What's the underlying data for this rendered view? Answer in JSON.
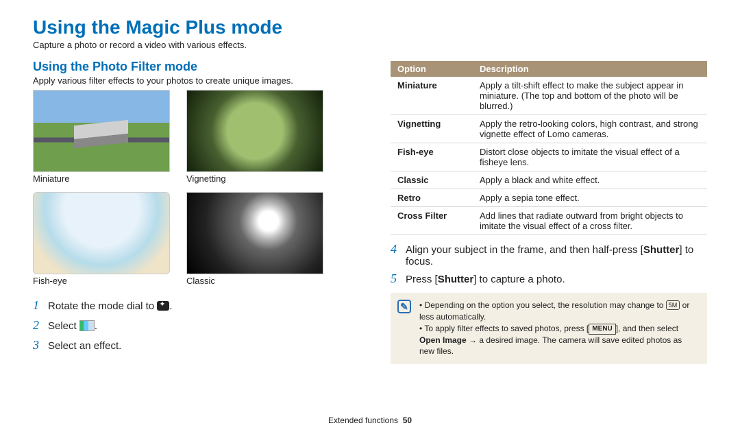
{
  "title": "Using the Magic Plus mode",
  "intro": "Capture a photo or record a video with various effects.",
  "section_title": "Using the Photo Filter mode",
  "section_desc": "Apply various filter effects to your photos to create unique images.",
  "thumbs": {
    "miniature": "Miniature",
    "vignetting": "Vignetting",
    "fisheye": "Fish-eye",
    "classic": "Classic"
  },
  "steps_left": {
    "s1": "Rotate the mode dial to ",
    "s1_suffix2": ".",
    "s2": "Select ",
    "s2_suffix": ".",
    "s3": "Select an effect."
  },
  "table": {
    "header_option": "Option",
    "header_desc": "Description",
    "rows": [
      {
        "name": "Miniature",
        "desc": "Apply a tilt-shift effect to make the subject appear in miniature. (The top and bottom of the photo will be blurred.)"
      },
      {
        "name": "Vignetting",
        "desc": "Apply the retro-looking colors, high contrast, and strong vignette effect of Lomo cameras."
      },
      {
        "name": "Fish-eye",
        "desc": "Distort close objects to imitate the visual effect of a fisheye lens."
      },
      {
        "name": "Classic",
        "desc": "Apply a black and white effect."
      },
      {
        "name": "Retro",
        "desc": "Apply a sepia tone effect."
      },
      {
        "name": "Cross Filter",
        "desc": "Add lines that radiate outward from bright objects to imitate the visual effect of a cross filter."
      }
    ]
  },
  "steps_right": {
    "s4_a": "Align your subject in the frame, and then half-press [",
    "s4_b": "Shutter",
    "s4_c": "] to focus.",
    "s5_a": "Press [",
    "s5_b": "Shutter",
    "s5_c": "] to capture a photo."
  },
  "note": {
    "bullet1_a": "Depending on the option you select, the resolution may change to ",
    "bullet1_res": "5M",
    "bullet1_b": " or less automatically.",
    "bullet2_a": "To apply filter effects to saved photos, press [",
    "bullet2_menu": "MENU",
    "bullet2_b": "], and then select ",
    "bullet2_open": "Open Image",
    "bullet2_c": " → a desired image. The camera will save edited photos as new files."
  },
  "footer": {
    "section": "Extended functions",
    "page": "50"
  }
}
